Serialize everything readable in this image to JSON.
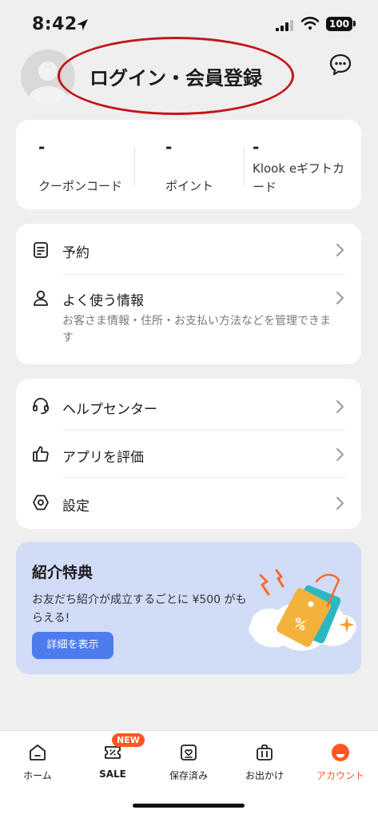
{
  "status_bar": {
    "time": "8:42",
    "battery": "100"
  },
  "header": {
    "login_label": "ログイン・会員登録"
  },
  "stats": [
    {
      "value": "-",
      "label": "クーポンコード"
    },
    {
      "value": "-",
      "label": "ポイント"
    },
    {
      "value": "-",
      "label": "Klook eギフトカード"
    }
  ],
  "menu1": {
    "reservation": "予約",
    "frequent_info": "よく使う情報",
    "frequent_info_sub": "お客さま情報・住所・お支払い方法などを管理できます"
  },
  "menu2": {
    "help": "ヘルプセンター",
    "rate_app": "アプリを評価",
    "settings": "設定"
  },
  "referral": {
    "title": "紹介特典",
    "description": "お友だち紹介が成立するごとに ¥500 がもらえる!",
    "button": "詳細を表示"
  },
  "bottom_nav": {
    "items": [
      {
        "label": "ホーム",
        "icon": "home-icon"
      },
      {
        "label": "SALE",
        "icon": "sale-ticket-icon",
        "badge": "NEW"
      },
      {
        "label": "保存済み",
        "icon": "saved-icon"
      },
      {
        "label": "お出かけ",
        "icon": "luggage-icon"
      },
      {
        "label": "アカウント",
        "icon": "account-icon"
      }
    ],
    "active_color": "#ff5722"
  },
  "colors": {
    "accent": "#ff5722",
    "button_blue": "#4d7cee",
    "annotation_red": "#c3161c"
  }
}
